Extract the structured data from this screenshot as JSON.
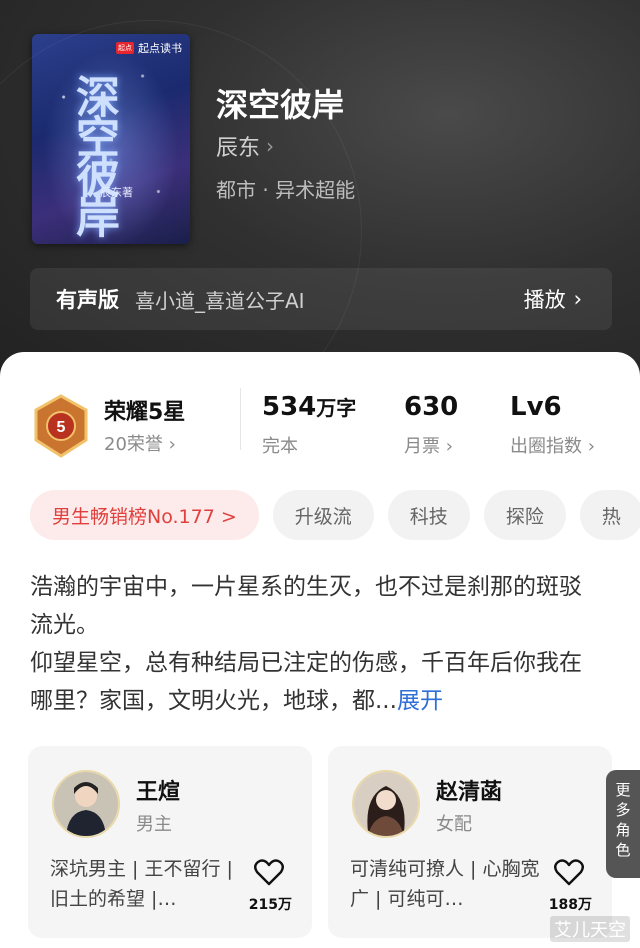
{
  "cover": {
    "publisher": "起点读书",
    "title_art": "深空彼岸",
    "author_art": "辰东著"
  },
  "book": {
    "title": "深空彼岸",
    "author": "辰东",
    "genre": "都市 · 异术超能"
  },
  "audio": {
    "label": "有声版",
    "narrator": "喜小道_喜道公子AI",
    "play_label": "播放"
  },
  "stats": {
    "honor": {
      "title": "荣耀5星",
      "sub": "20荣誉",
      "level": "5"
    },
    "words": {
      "value": "534",
      "unit": "万字",
      "sub": "完本"
    },
    "monthly": {
      "value": "630",
      "sub": "月票"
    },
    "influence": {
      "value": "Lv6",
      "sub": "出圈指数"
    }
  },
  "tags": [
    "男生畅销榜No.177 >",
    "升级流",
    "科技",
    "探险",
    "热"
  ],
  "synopsis": {
    "line1": "浩瀚的宇宙中，一片星系的生灭，也不过是刹那的斑驳流光。",
    "line2": "仰望星空，总有种结局已注定的伤感，千百年后你我在哪里？家国，文明火光，地球，都...",
    "expand": "展开"
  },
  "characters": [
    {
      "name": "王煊",
      "role": "男主",
      "desc": "深坑男主 | 王不留行 | 旧土的希望 |…",
      "likes": "215万"
    },
    {
      "name": "赵清菡",
      "role": "女配",
      "desc": "可清纯可撩人 | 心胸宽广 | 可纯可…",
      "likes": "188万"
    }
  ],
  "more_roles": "更多角色",
  "watermark": "艾儿天空",
  "colors": {
    "hot_tag": "#e0403d",
    "expand": "#2d6fd6",
    "card_bg": "#f5f5f5"
  }
}
